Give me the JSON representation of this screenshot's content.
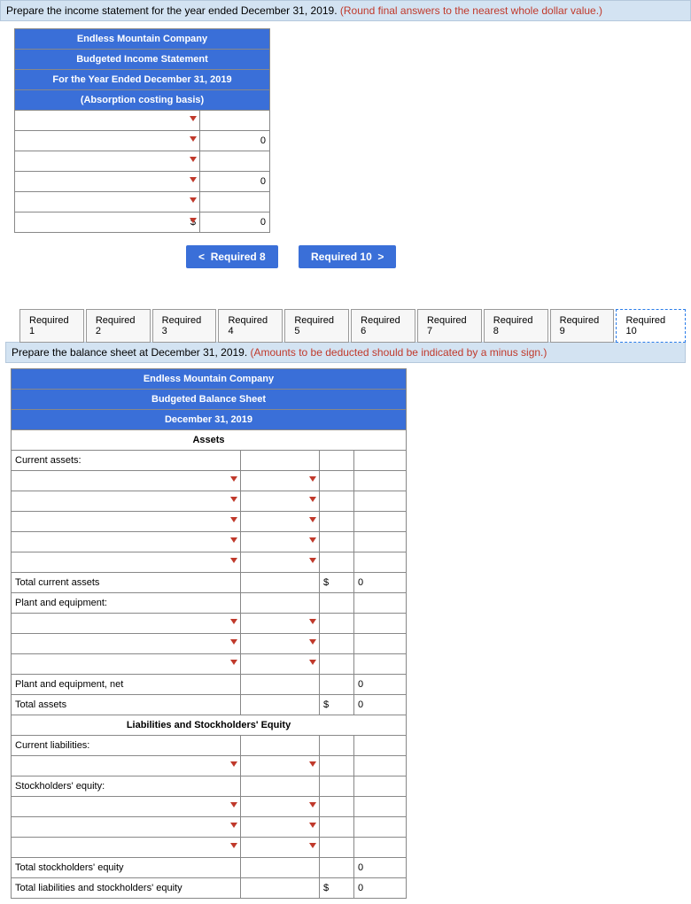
{
  "section1": {
    "instruction_main": "Prepare the income statement for the year ended December 31, 2019. ",
    "instruction_red": "(Round final answers to the nearest whole dollar value.)",
    "header_company": "Endless Mountain Company",
    "header_title": "Budgeted Income Statement",
    "header_period": "For the Year Ended December 31, 2019",
    "header_basis": "(Absorption costing basis)",
    "rows": [
      {
        "label": "",
        "val": ""
      },
      {
        "label": "",
        "val": "0"
      },
      {
        "label": "",
        "val": ""
      },
      {
        "label": "",
        "val": "0"
      },
      {
        "label": "",
        "val": ""
      },
      {
        "label": "$",
        "val": "0"
      }
    ]
  },
  "nav": {
    "prev": "Required 8",
    "next": "Required 10"
  },
  "tabs": [
    "Required 1",
    "Required 2",
    "Required 3",
    "Required 4",
    "Required 5",
    "Required 6",
    "Required 7",
    "Required 8",
    "Required 9",
    "Required 10"
  ],
  "section2": {
    "instruction_main": "Prepare the balance sheet at December 31, 2019. ",
    "instruction_red": "(Amounts to be deducted should be indicated by a minus sign.)",
    "header_company": "Endless Mountain Company",
    "header_title": "Budgeted Balance Sheet",
    "header_period": "December 31, 2019",
    "header_assets": "Assets",
    "lbl_current_assets": "Current assets:",
    "lbl_total_current_assets": "Total current assets",
    "lbl_plant_equip": "Plant and equipment:",
    "lbl_plant_equip_net": "Plant and equipment, net",
    "lbl_total_assets": "Total assets",
    "header_liab": "Liabilities and Stockholders' Equity",
    "lbl_current_liab": "Current liabilities:",
    "lbl_stockholders": "Stockholders' equity:",
    "lbl_total_stockholders": "Total stockholders' equity",
    "lbl_total_liab_equity": "Total liabilities and stockholders' equity",
    "sym": "$",
    "zero": "0"
  }
}
